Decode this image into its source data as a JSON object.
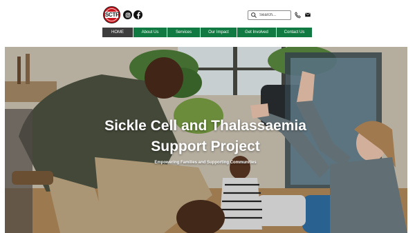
{
  "header": {
    "logo_text": "SCTFT",
    "social": [
      {
        "name": "instagram-icon"
      },
      {
        "name": "facebook-icon"
      }
    ],
    "search_placeholder": "Search..."
  },
  "nav": {
    "items": [
      {
        "label": "HOME",
        "active": true
      },
      {
        "label": "About Us",
        "active": false
      },
      {
        "label": "Services",
        "active": false
      },
      {
        "label": "Our Impact",
        "active": false
      },
      {
        "label": "Get Involved",
        "active": false
      },
      {
        "label": "Contact Us",
        "active": false
      }
    ]
  },
  "hero": {
    "title_line1": "Sickle Cell and Thalassaemia",
    "title_line2": "Support Project",
    "subtitle": "Empowering Families and Supporting Communities"
  },
  "colors": {
    "nav_green": "#117a42",
    "nav_active": "#3d3d3d",
    "logo_red": "#c8141c"
  }
}
